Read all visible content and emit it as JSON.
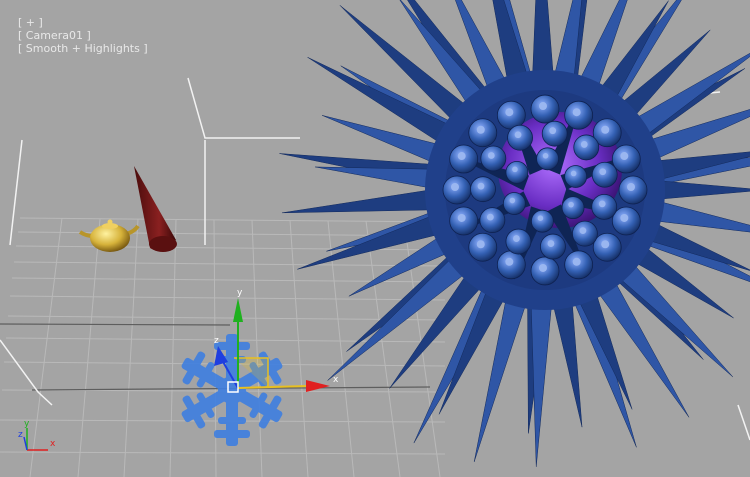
{
  "viewport": {
    "menu_plus": "[ + ]",
    "camera": "[ Camera01 ]",
    "shading": "[ Smooth + Highlights ]"
  },
  "gizmo": {
    "x_label": "x",
    "y_label": "y",
    "z_label": "z"
  },
  "view_axes": {
    "x_label": "x",
    "y_label": "y",
    "z_label": "z"
  },
  "colors": {
    "viewport_bg": "#a4a4a4",
    "grid": "#b9b9b9",
    "spikes": "#2f56a6",
    "core": "#6a2ec4",
    "teapot": "#d6b23a",
    "cone": "#7a1a1a",
    "snowflake": "#3f7fe0",
    "gizmo_x": "#e02020",
    "gizmo_y": "#1fb11f",
    "gizmo_z": "#1f3fe0",
    "selection": "#e8c020"
  }
}
